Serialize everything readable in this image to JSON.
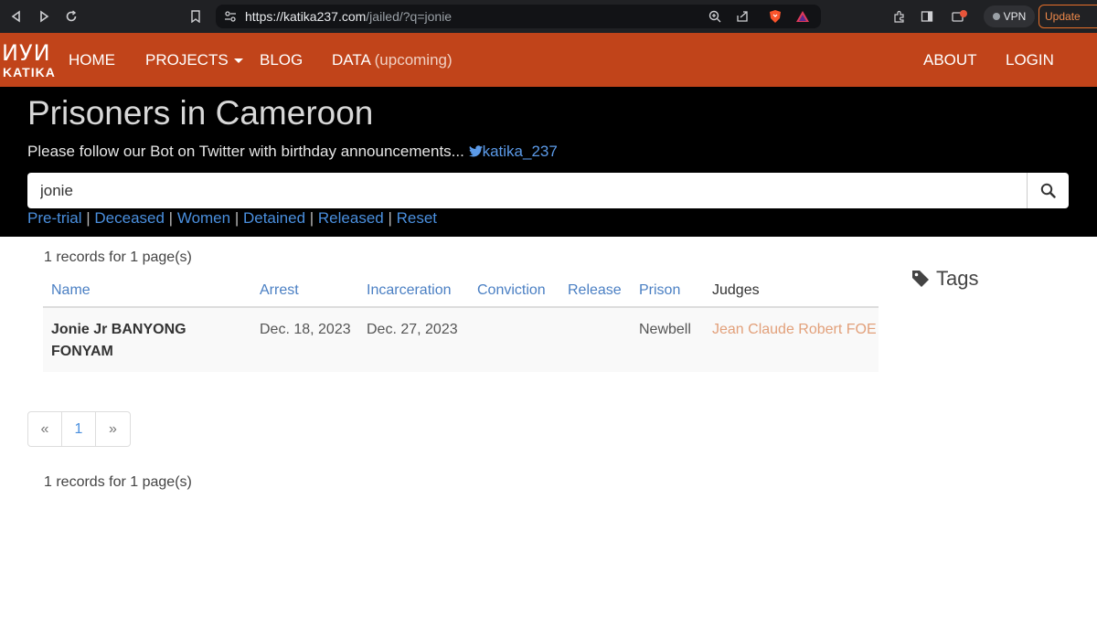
{
  "browser": {
    "url_host": "https://katika237.com",
    "url_path": "/jailed/?q=jonie",
    "vpn_label": "VPN",
    "update_label": "Update"
  },
  "nav": {
    "logo_glyph": "ИУИ",
    "logo_word": "KATIKA",
    "home": "HOME",
    "projects": "PROJECTS",
    "blog": "BLOG",
    "data": "DATA",
    "data_suffix": "(upcoming)",
    "about": "ABOUT",
    "login": "LOGIN"
  },
  "hero": {
    "title": "Prisoners in Cameroon",
    "follow_text": "Please follow our Bot on Twitter with birthday announcements...",
    "twitter_handle": "katika_237"
  },
  "search": {
    "value": "jonie"
  },
  "filters": [
    "Pre-trial",
    "Deceased",
    "Women",
    "Detained",
    "Released",
    "Reset"
  ],
  "summary_top": "1 records for 1 page(s)",
  "summary_bottom": "1 records for 1 page(s)",
  "table": {
    "headers": [
      "Name",
      "Arrest",
      "Incarceration",
      "Conviction",
      "Release",
      "Prison",
      "Judges"
    ],
    "rows": [
      {
        "name": "Jonie Jr BANYONG FONYAM",
        "arrest": "Dec. 18, 2023",
        "incarceration": "Dec. 27, 2023",
        "conviction": "",
        "release": "",
        "prison": "Newbell",
        "judge": "Jean Claude Robert FOE"
      }
    ]
  },
  "tags_label": "Tags",
  "pagination": {
    "prev": "«",
    "page": "1",
    "next": "»"
  },
  "colors": {
    "navbar": "#c1441a",
    "link": "#4a8fde",
    "judge_link": "#e2a07a"
  }
}
